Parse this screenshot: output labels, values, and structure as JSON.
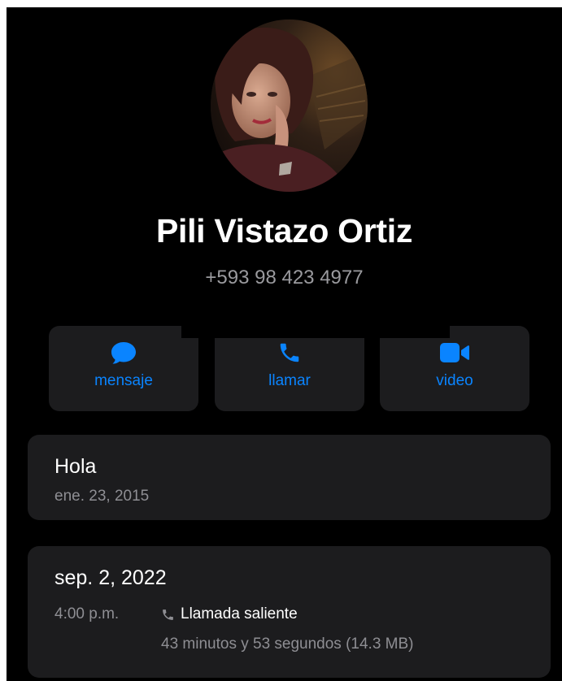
{
  "contact": {
    "name": "Pili Vistazo Ortiz",
    "phone": "+593 98 423 4977"
  },
  "actions": [
    {
      "label": "mensaje",
      "icon": "message-bubble-icon"
    },
    {
      "label": "llamar",
      "icon": "phone-icon"
    },
    {
      "label": "video",
      "icon": "video-camera-icon"
    }
  ],
  "colors": {
    "accent": "#0a84ff",
    "background": "#000000",
    "card": "#1c1c1e",
    "secondary_text": "#8e8e93"
  },
  "status_card": {
    "title": "Hola",
    "date": "ene. 23, 2015"
  },
  "call_card": {
    "date": "sep. 2, 2022",
    "time": "4:00 p.m.",
    "call_icon": "phone-icon",
    "call_type": "Llamada saliente",
    "duration": "43 minutos y 53 segundos (14.3 MB)"
  }
}
